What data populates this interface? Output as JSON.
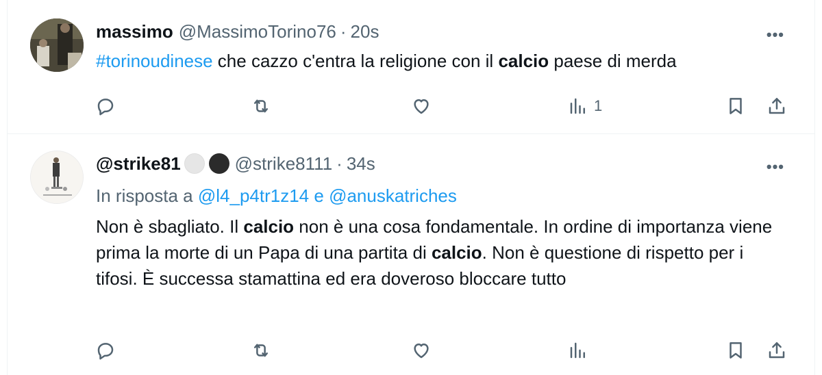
{
  "tweets": [
    {
      "name": "massimo",
      "handle": "@MassimoTorino76",
      "separator": "·",
      "time": "20s",
      "more": "•••",
      "text": {
        "hashtag": "#torinoudinese",
        "part1": " che cazzo c'entra la religione con il ",
        "bold1": "calcio",
        "part2": " paese di merda"
      },
      "views": "1"
    },
    {
      "name": "@strike81",
      "handle": "@strike8111",
      "separator": "·",
      "time": "34s",
      "more": "•••",
      "replying": {
        "prefix": "In risposta a ",
        "mention1": "@l4_p4tr1z14",
        "joiner": " e ",
        "mention2": "@anuskatriches"
      },
      "text": {
        "part1": "Non è sbagliato. Il ",
        "bold1": "calcio",
        "part2": " non è una cosa fondamentale. In ordine di importanza viene prima la morte di un Papa di una partita di ",
        "bold2": "calcio",
        "part3": ". Non è questione di rispetto per i tifosi. È successa stamattina ed era doveroso bloccare tutto"
      },
      "views": ""
    }
  ],
  "icons": [
    "reply-icon",
    "retweet-icon",
    "like-icon",
    "views-icon",
    "bookmark-icon",
    "share-icon",
    "more-icon"
  ],
  "colors": {
    "link": "#1d9bf0",
    "secondary": "#536471",
    "text": "#0f1419",
    "border": "#eff3f4"
  }
}
